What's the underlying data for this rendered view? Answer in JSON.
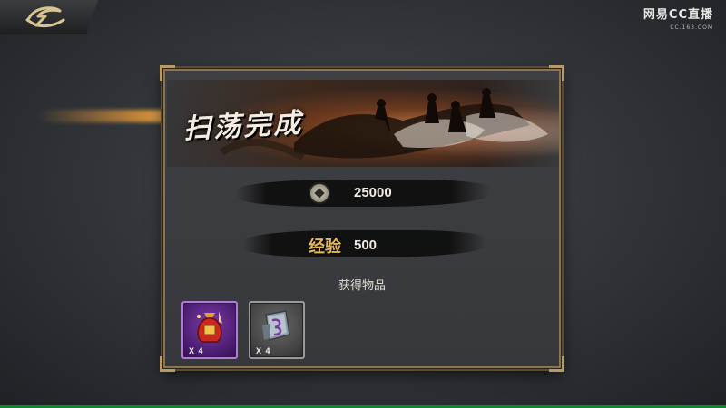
{
  "watermark": {
    "brand": "网易CC直播",
    "sub": "CC.163.COM"
  },
  "panel": {
    "title": "扫荡完成",
    "gold": {
      "icon": "coin-icon",
      "value": "25000"
    },
    "exp": {
      "label": "经验",
      "value": "500"
    },
    "items_heading": "获得物品",
    "items": [
      {
        "icon": "lucky-bag-icon",
        "quantity": "X   4",
        "rarity_color": "#b07ad8"
      },
      {
        "icon": "scroll-fragment-icon",
        "quantity": "X   4",
        "rarity_color": "#9a9a9a"
      }
    ]
  },
  "colors": {
    "frame": "#8a7451",
    "exp_label": "#e8b95a",
    "status_bar": "#0a8a2a"
  }
}
